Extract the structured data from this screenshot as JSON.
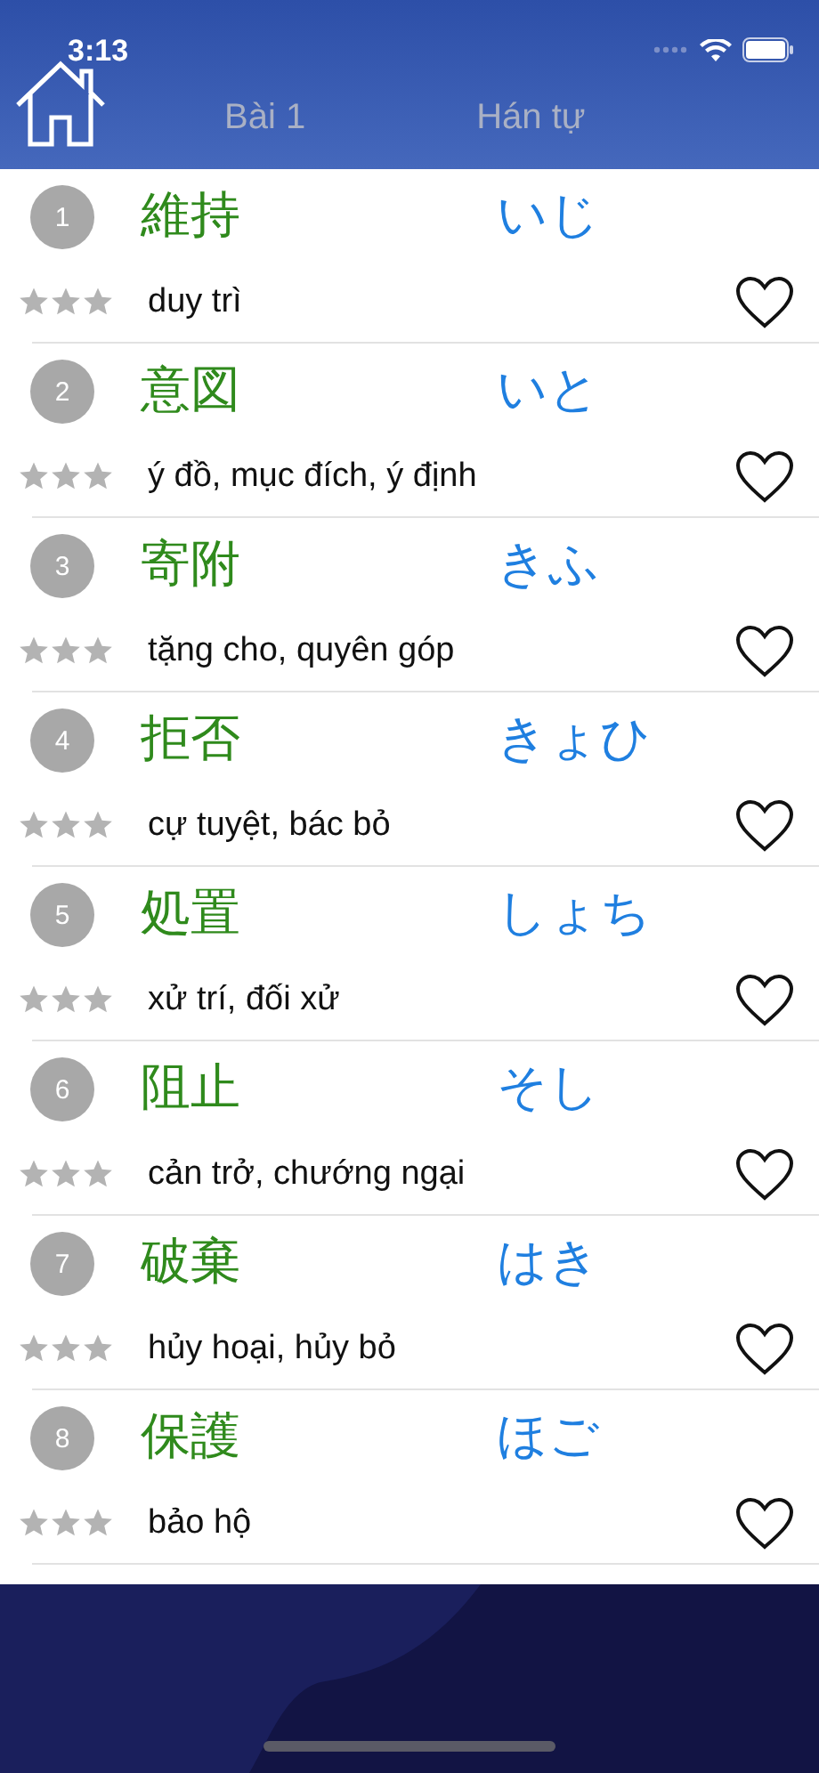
{
  "status_bar": {
    "time": "3:13"
  },
  "header": {
    "tabs": [
      {
        "label": "Bài 1"
      },
      {
        "label": "Hán tự"
      }
    ]
  },
  "words": [
    {
      "number": "1",
      "kanji": "維持",
      "reading": "いじ",
      "meaning": "duy trì",
      "stars": 0,
      "favorite": false
    },
    {
      "number": "2",
      "kanji": "意図",
      "reading": "いと",
      "meaning": "ý đồ, mục đích, ý định",
      "stars": 0,
      "favorite": false
    },
    {
      "number": "3",
      "kanji": "寄附",
      "reading": "きふ",
      "meaning": "tặng cho, quyên góp",
      "stars": 0,
      "favorite": false
    },
    {
      "number": "4",
      "kanji": "拒否",
      "reading": "きょひ",
      "meaning": "cự tuyệt, bác bỏ",
      "stars": 0,
      "favorite": false
    },
    {
      "number": "5",
      "kanji": "処置",
      "reading": "しょち",
      "meaning": "xử trí, đối xử",
      "stars": 0,
      "favorite": false
    },
    {
      "number": "6",
      "kanji": "阻止",
      "reading": "そし",
      "meaning": "cản trở, chướng ngại",
      "stars": 0,
      "favorite": false
    },
    {
      "number": "7",
      "kanji": "破棄",
      "reading": "はき",
      "meaning": "hủy hoại, hủy bỏ",
      "stars": 0,
      "favorite": false
    },
    {
      "number": "8",
      "kanji": "保護",
      "reading": "ほご",
      "meaning": "bảo hộ",
      "stars": 0,
      "favorite": false
    }
  ]
}
